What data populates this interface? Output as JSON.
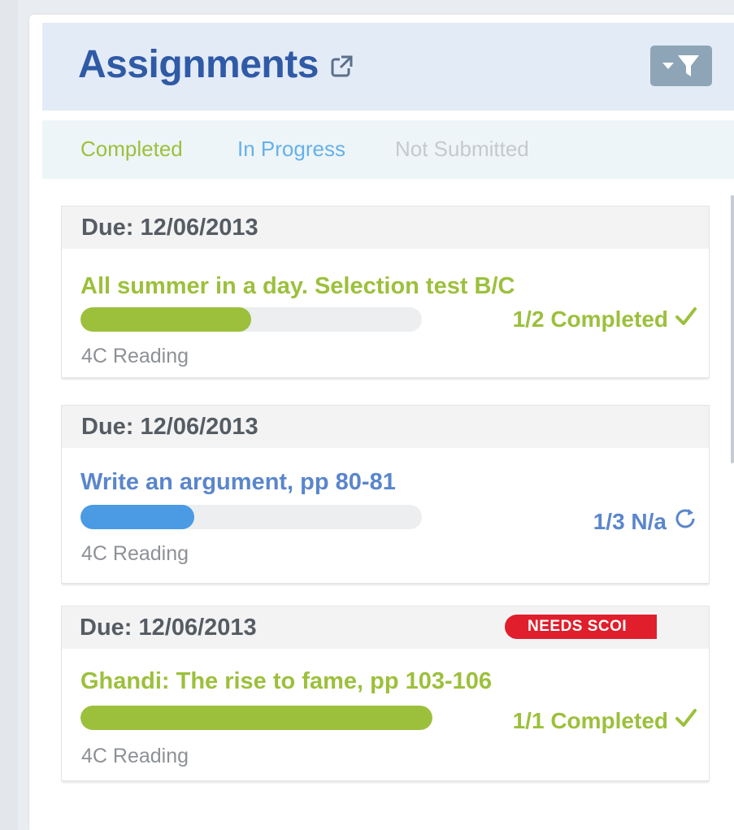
{
  "header": {
    "title": "Assignments"
  },
  "tabs": [
    {
      "label": "Completed"
    },
    {
      "label": "In Progress"
    },
    {
      "label": "Not Submitted"
    }
  ],
  "assignments": [
    {
      "due": "Due: 12/06/2013",
      "title": "All summer in a day. Selection test B/C",
      "progress": 0.5,
      "status": "1/2 Completed",
      "status_icon": "check-icon",
      "course": "4C Reading",
      "color": "#9cc03c"
    },
    {
      "due": "Due: 12/06/2013",
      "title": "Write an argument, pp 80-81",
      "progress": 0.333,
      "status": "1/3 N/a",
      "status_icon": "refresh-icon",
      "course": "4C Reading",
      "color": "#4a9ae4"
    },
    {
      "due": "Due: 12/06/2013",
      "badge": "NEEDS SCOI",
      "title": "Ghandi: The rise to fame, pp 103-106",
      "progress": 1.0,
      "status": "1/1 Completed",
      "status_icon": "check-icon",
      "course": "4C Reading",
      "color": "#9cc03c"
    }
  ]
}
